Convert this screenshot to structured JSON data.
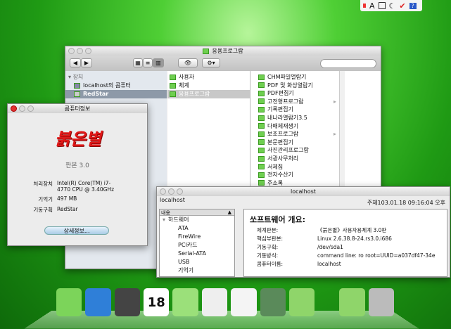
{
  "menubar": {
    "icons": [
      "input-icon",
      "font-icon",
      "book-icon",
      "volume-icon",
      "check-icon",
      "help-icon"
    ],
    "font_label": "A",
    "help_label": "?"
  },
  "finder": {
    "title": "응용프로그람",
    "search_placeholder": "",
    "sidebar": {
      "section": "장치",
      "items": [
        "localhost의 콤퓨터",
        "RedStar"
      ]
    },
    "column1": [
      "사용자",
      "체계",
      "응용프로그람"
    ],
    "column2": [
      "CHM파일열람기",
      "PDF 및 화상열람기",
      "PDF편집기",
      "고전형프로그람",
      "기록편집기",
      "내나라열람기3.5",
      "다매체재생기",
      "보조프로그람",
      "본문편집기",
      "사진관리프로그람",
      "서광사무처리",
      "서체집",
      "전자수산기",
      "주소록"
    ]
  },
  "about": {
    "title": "콤퓨터정보",
    "logo_text": "붉은별",
    "version": "판본 3.0",
    "specs": [
      {
        "label": "처리장치",
        "value": "Intel(R) Core(TM) i7-4770 CPU @ 3.40GHz"
      },
      {
        "label": "기억기",
        "value": "497 MB"
      },
      {
        "label": "기동구획",
        "value": "RedStar"
      }
    ],
    "more_button": "상세정보..."
  },
  "sysinfo": {
    "title": "localhost",
    "host": "localhost",
    "datetime": "주체103.01.18 09:16:04 오후",
    "tree_header": "내용",
    "tree": [
      "하드웨어",
      "ATA",
      "FireWire",
      "PCI카드",
      "Serial-ATA",
      "USB",
      "기억기"
    ],
    "heading": "쏘프트웨어 개요:",
    "details": [
      {
        "label": "체계판본:",
        "value": "《붉은별》사용자용체계 3.0판"
      },
      {
        "label": "핵심부판본:",
        "value": "Linux 2.6.38.8-24.rs3.0.i686"
      },
      {
        "label": "기동구획:",
        "value": "/dev/sda1"
      },
      {
        "label": "기동방식:",
        "value": "command line: ro root=UUID=a037df47-34e"
      },
      {
        "label": "콤퓨터이름:",
        "value": "localhost"
      }
    ]
  },
  "dock": {
    "items": [
      {
        "name": "files-icon"
      },
      {
        "name": "browser-globe-icon"
      },
      {
        "name": "video-player-icon"
      },
      {
        "name": "calendar-icon",
        "label": "18"
      },
      {
        "name": "address-book-icon"
      },
      {
        "name": "image-viewer-icon"
      },
      {
        "name": "calculator-icon"
      },
      {
        "name": "system-tools-icon"
      },
      {
        "name": "help-memory-icon"
      },
      {
        "name": "documents-folder-icon"
      },
      {
        "name": "trash-icon"
      }
    ]
  }
}
